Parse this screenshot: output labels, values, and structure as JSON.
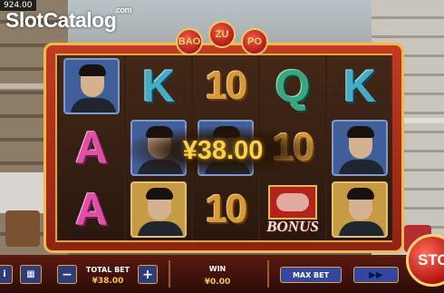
{
  "balance": "924.00",
  "logo": {
    "text": "SlotCatalog",
    "suffix": ".com"
  },
  "title_plaques": [
    "BAO",
    "ZU",
    "PO"
  ],
  "reels": [
    [
      {
        "type": "portrait",
        "style": "blue",
        "icon": "young-man-portrait-icon"
      },
      {
        "type": "letter",
        "value": "A",
        "cls": "let-a"
      },
      {
        "type": "letter",
        "value": "A",
        "cls": "let-a"
      }
    ],
    [
      {
        "type": "letter",
        "value": "K",
        "cls": "let-k"
      },
      {
        "type": "portrait",
        "style": "blue",
        "icon": "young-man-portrait-icon"
      },
      {
        "type": "portrait",
        "style": "gold",
        "icon": "bearded-man-portrait-icon"
      }
    ],
    [
      {
        "type": "letter",
        "value": "10",
        "cls": "num-10"
      },
      {
        "type": "portrait",
        "style": "blue",
        "icon": "young-man-portrait-icon"
      },
      {
        "type": "letter",
        "value": "10",
        "cls": "num-10"
      }
    ],
    [
      {
        "type": "letter",
        "value": "Q",
        "cls": "let-q"
      },
      {
        "type": "letter",
        "value": "10",
        "cls": "num-10"
      },
      {
        "type": "bonus",
        "value": "BONUS",
        "icon": "pig-bonus-icon"
      }
    ],
    [
      {
        "type": "letter",
        "value": "K",
        "cls": "let-k"
      },
      {
        "type": "portrait",
        "style": "blue",
        "icon": "young-man-portrait-icon"
      },
      {
        "type": "portrait",
        "style": "gold",
        "icon": "bearded-man-portrait-icon"
      }
    ]
  ],
  "win_banner": "¥38.00",
  "controls": {
    "minus": "−",
    "plus": "+",
    "total_bet_label": "TOTAL BET",
    "total_bet_value": "¥38.00",
    "win_label": "WIN",
    "win_value": "¥0.00",
    "max_bet": "MAX BET",
    "fast_forward": "▶▶",
    "stop": "STO"
  },
  "colors": {
    "frame": "#c43a22",
    "gold": "#f0b94a",
    "win_text": "#f8d24a"
  }
}
